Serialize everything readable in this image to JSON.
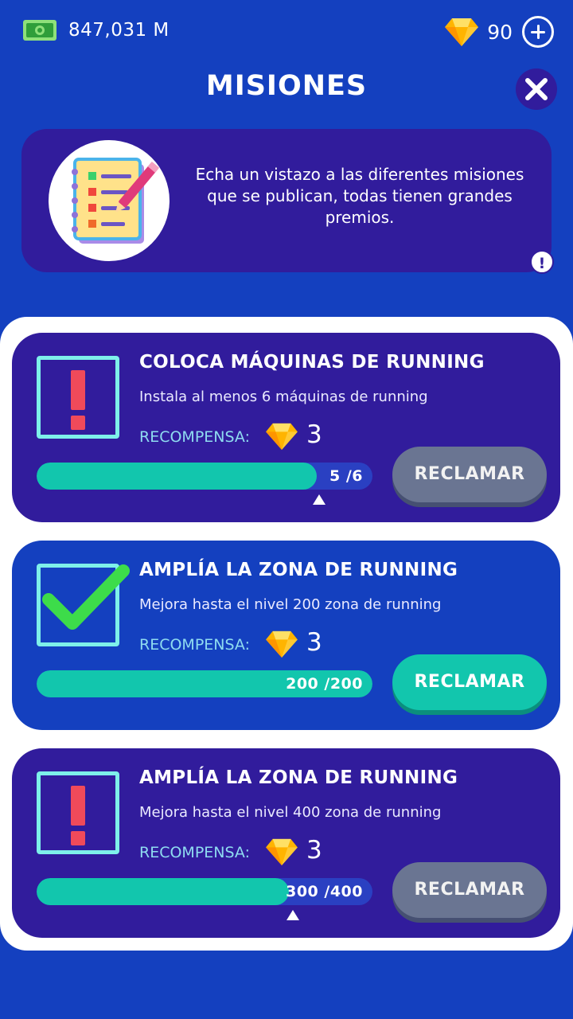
{
  "header": {
    "cash": "847,031 M",
    "gems": "90",
    "title": "MISIONES"
  },
  "intro": {
    "text": "Echa un vistazo a las diferentes misiones que se publican, todas tienen grandes premios.",
    "info_badge": "!"
  },
  "missions": [
    {
      "title": "COLOCA MÁQUINAS DE RUNNING",
      "description": "Instala al menos 6  máquinas de running",
      "reward_label": "RECOMPENSA:",
      "reward": "3",
      "progress_text": "5 /6",
      "progress": 0.833,
      "completed": false,
      "button_label": "RECLAMAR"
    },
    {
      "title": "AMPLÍA LA ZONA DE RUNNING",
      "description": "Mejora hasta el nivel 200  zona de running",
      "reward_label": "RECOMPENSA:",
      "reward": "3",
      "progress_text": "200 /200",
      "progress": 1.0,
      "completed": true,
      "button_label": "RECLAMAR"
    },
    {
      "title": "AMPLÍA LA ZONA DE RUNNING",
      "description": "Mejora hasta el nivel 400  zona de running",
      "reward_label": "RECOMPENSA:",
      "reward": "3",
      "progress_text": "300 /400",
      "progress": 0.75,
      "completed": false,
      "button_label": "RECLAMAR"
    }
  ],
  "colors": {
    "background": "#1440bf",
    "card": "#311c9c",
    "progress_fill": "#12c6ad",
    "claim_disabled": "#6a7592",
    "claim_active": "#12c6ad",
    "alert": "#f04a5a",
    "check": "#3ddc4a"
  },
  "icons": [
    "cash-icon",
    "gem-icon",
    "plus-icon",
    "close-icon",
    "notebook-icon",
    "info-icon",
    "alert-icon",
    "check-icon"
  ]
}
